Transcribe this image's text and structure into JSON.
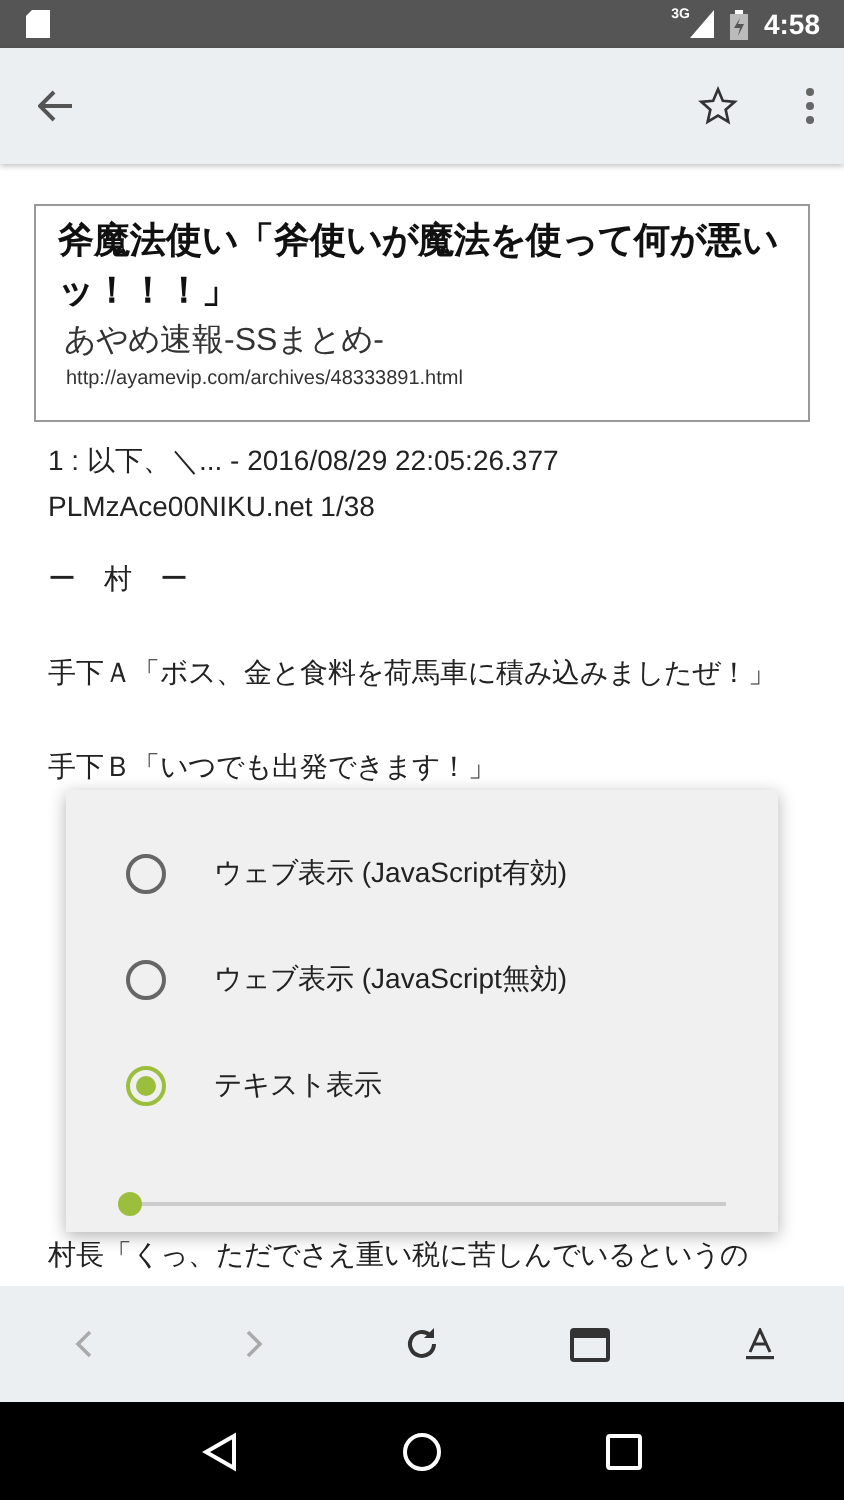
{
  "status_bar": {
    "network": "3G",
    "time": "4:58"
  },
  "article": {
    "title": "斧魔法使い「斧使いが魔法を使って何が悪いッ！！！」",
    "site": "あやめ速報-SSまとめ-",
    "url": "http://ayamevip.com/archives/48333891.html"
  },
  "paragraphs": [
    {
      "lines": [
        "1 : 以下、＼... - 2016/08/29 22:05:26.377",
        "PLMzAce00NIKU.net 1/38"
      ]
    },
    {
      "lines": [
        "ー　村　ー"
      ]
    },
    {
      "lines": [
        "手下Ａ「ボス、金と食料を荷馬車に積み込みましたぜ！」"
      ]
    },
    {
      "lines": [
        "手下Ｂ「いつでも出発できます！」"
      ]
    },
    {
      "lines": [
        "村長「くっ、ただでさえ重い税に苦しんでいるというの"
      ]
    }
  ],
  "dialog": {
    "options": [
      {
        "label": "ウェブ表示 (JavaScript有効)",
        "selected": false
      },
      {
        "label": "ウェブ表示 (JavaScript無効)",
        "selected": false
      },
      {
        "label": "テキスト表示",
        "selected": true
      }
    ],
    "slider": {
      "level": 0
    }
  },
  "bottom_toolbar": [
    {
      "kind": "back",
      "disabled": true
    },
    {
      "kind": "forward",
      "disabled": true
    },
    {
      "kind": "reload",
      "disabled": false
    },
    {
      "kind": "tabs",
      "disabled": false
    },
    {
      "kind": "font",
      "disabled": false
    }
  ]
}
